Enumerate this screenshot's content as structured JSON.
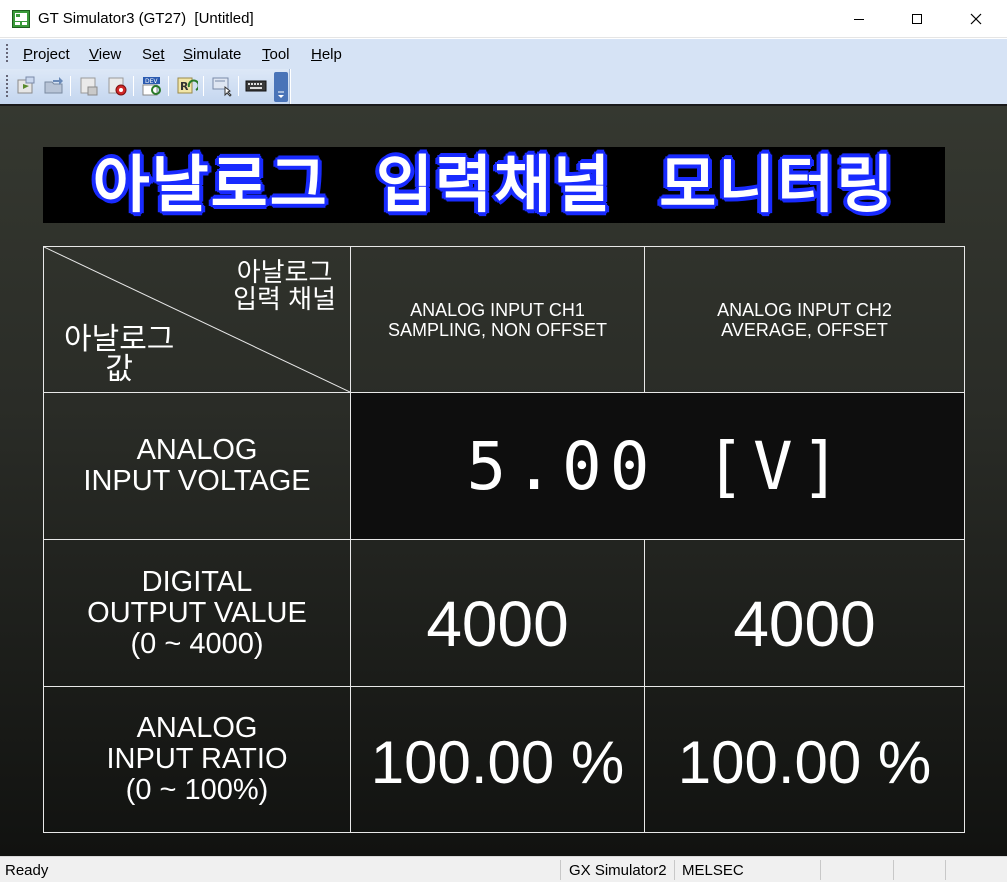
{
  "window": {
    "title": "GT Simulator3 (GT27)  [Untitled]",
    "controls": {
      "minimize": "minimize-icon",
      "maximize": "maximize-icon",
      "close": "close-icon"
    }
  },
  "menu": [
    {
      "label": "Project",
      "accel": "P",
      "rest": "roject"
    },
    {
      "label": "View",
      "accel": "V",
      "rest": "iew"
    },
    {
      "label": "Set",
      "accel": "S",
      "rest": "et",
      "prefix": ""
    },
    {
      "label": "Simulate",
      "accel": "S",
      "rest": "imulate"
    },
    {
      "label": "Tool",
      "accel": "T",
      "rest": "ool"
    },
    {
      "label": "Help",
      "accel": "H",
      "rest": "elp"
    }
  ],
  "toolbar": {
    "buttons": [
      "open-project-icon",
      "open-icon",
      "stop-icon",
      "record-icon",
      "device-monitor-icon",
      "refresh-icon",
      "touch-icon",
      "keyboard-icon"
    ],
    "dropdown": "toolbar-options-icon"
  },
  "screen": {
    "banner": "아날로그  입력채널  모니터링",
    "banner_colors": {
      "fill": "#ffffff",
      "outline": "#1a2cff",
      "background": "#000000"
    },
    "corner_top": "아날로그\n입력 채널",
    "corner_bottom": "아날로그\n값",
    "ch1_header": "ANALOG INPUT  CH1\nSAMPLING, NON OFFSET",
    "ch2_header": "ANALOG INPUT CH2\nAVERAGE, OFFSET",
    "rows": {
      "voltage": {
        "label": "ANALOG\nINPUT VOLTAGE",
        "value": "5.00 [V]"
      },
      "digital": {
        "label": "DIGITAL\nOUTPUT VALUE\n(0 ~ 4000)",
        "ch1": "4000",
        "ch2": "4000"
      },
      "ratio": {
        "label": "ANALOG\nINPUT RATIO\n(0 ~ 100%)",
        "ch1": "100.00 %",
        "ch2": "100.00 %"
      }
    }
  },
  "status": {
    "left": "Ready",
    "plc": "GX Simulator2",
    "series": "MELSEC"
  }
}
